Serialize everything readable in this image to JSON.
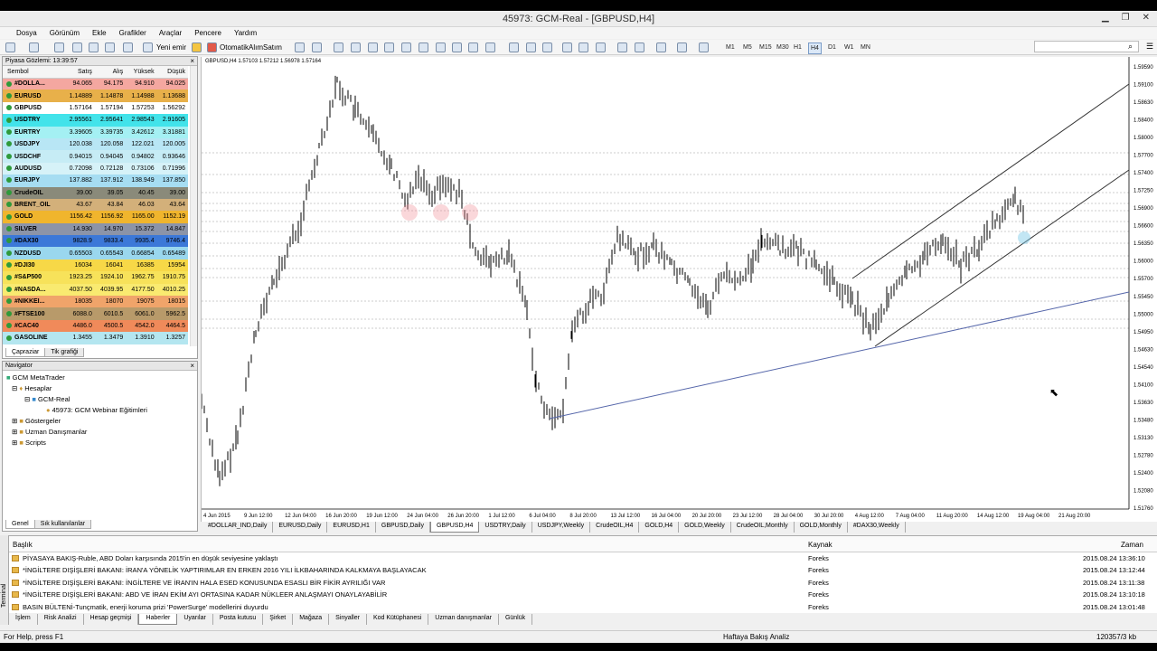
{
  "window": {
    "title": "45973: GCM-Real - [GBPUSD,H4]"
  },
  "menu": [
    "Dosya",
    "Görünüm",
    "Ekle",
    "Grafikler",
    "Araçlar",
    "Pencere",
    "Yardım"
  ],
  "toolbar": {
    "new_order": "Yeni emir",
    "auto_trading": "OtomatikAlımSatım",
    "timeframes": [
      "M1",
      "M5",
      "M15",
      "M30",
      "H1",
      "H4",
      "D1",
      "W1",
      "MN"
    ]
  },
  "market_watch": {
    "title": "Piyasa Gözlemi: 13:39:57",
    "columns": [
      "Sembol",
      "Satış",
      "Alış",
      "Yüksek",
      "Düşük"
    ],
    "rows": [
      {
        "sym": "#DOLLA...",
        "bid": "94.065",
        "ask": "94.175",
        "high": "94.910",
        "low": "94.025",
        "bg": "#f4a7a0"
      },
      {
        "sym": "EURUSD",
        "bid": "1.14889",
        "ask": "1.14878",
        "high": "1.14988",
        "low": "1.13688",
        "bg": "#e8b04a"
      },
      {
        "sym": "GBPUSD",
        "bid": "1.57164",
        "ask": "1.57194",
        "high": "1.57253",
        "low": "1.56292",
        "bg": "#ffffff"
      },
      {
        "sym": "USDTRY",
        "bid": "2.95561",
        "ask": "2.95641",
        "high": "2.98543",
        "low": "2.91605",
        "bg": "#42e3ea"
      },
      {
        "sym": "EURTRY",
        "bid": "3.39605",
        "ask": "3.39735",
        "high": "3.42612",
        "low": "3.31881",
        "bg": "#a4f0f3"
      },
      {
        "sym": "USDJPY",
        "bid": "120.038",
        "ask": "120.058",
        "high": "122.021",
        "low": "120.005",
        "bg": "#b8e6f5"
      },
      {
        "sym": "USDCHF",
        "bid": "0.94015",
        "ask": "0.94045",
        "high": "0.94802",
        "low": "0.93646",
        "bg": "#c6ecf5"
      },
      {
        "sym": "AUDUSD",
        "bid": "0.72098",
        "ask": "0.72128",
        "high": "0.73106",
        "low": "0.71996",
        "bg": "#d6f2f8"
      },
      {
        "sym": "EURJPY",
        "bid": "137.882",
        "ask": "137.912",
        "high": "138.949",
        "low": "137.850",
        "bg": "#a6ddf2"
      },
      {
        "sym": "CrudeOIL",
        "bid": "39.00",
        "ask": "39.05",
        "high": "40.45",
        "low": "39.00",
        "bg": "#8a8a7a"
      },
      {
        "sym": "BRENT_OIL",
        "bid": "43.67",
        "ask": "43.84",
        "high": "46.03",
        "low": "43.64",
        "bg": "#d3b07a"
      },
      {
        "sym": "GOLD",
        "bid": "1156.42",
        "ask": "1156.92",
        "high": "1165.00",
        "low": "1152.19",
        "bg": "#f0b52d"
      },
      {
        "sym": "SILVER",
        "bid": "14.930",
        "ask": "14.970",
        "high": "15.372",
        "low": "14.847",
        "bg": "#8c94a8"
      },
      {
        "sym": "#DAX30",
        "bid": "9828.9",
        "ask": "9833.4",
        "high": "9935.4",
        "low": "9746.4",
        "bg": "#3c78d8"
      },
      {
        "sym": "NZDUSD",
        "bid": "0.65503",
        "ask": "0.65543",
        "high": "0.66854",
        "low": "0.65489",
        "bg": "#9ad7ee"
      },
      {
        "sym": "#DJI30",
        "bid": "16034",
        "ask": "16041",
        "high": "16385",
        "low": "15954",
        "bg": "#f7d847"
      },
      {
        "sym": "#S&P500",
        "bid": "1923.25",
        "ask": "1924.10",
        "high": "1962.75",
        "low": "1910.75",
        "bg": "#f7e25a"
      },
      {
        "sym": "#NASDA...",
        "bid": "4037.50",
        "ask": "4039.95",
        "high": "4177.50",
        "low": "4010.25",
        "bg": "#f9ea70"
      },
      {
        "sym": "#NIKKEI...",
        "bid": "18035",
        "ask": "18070",
        "high": "19075",
        "low": "18015",
        "bg": "#f0a46a"
      },
      {
        "sym": "#FTSE100",
        "bid": "6088.0",
        "ask": "6010.5",
        "high": "6061.0",
        "low": "5962.5",
        "bg": "#b89a6a"
      },
      {
        "sym": "#CAC40",
        "bid": "4486.0",
        "ask": "4500.5",
        "high": "4542.0",
        "low": "4464.5",
        "bg": "#f08a5a"
      },
      {
        "sym": "GASOLINE",
        "bid": "1.3455",
        "ask": "1.3479",
        "high": "1.3910",
        "low": "1.3257",
        "bg": "#b4e6f0"
      }
    ],
    "tabs": [
      "Çapraziar",
      "Tik grafiği"
    ]
  },
  "navigator": {
    "title": "Navigator",
    "root": "GCM MetaTrader",
    "accounts": "Hesaplar",
    "server": "GCM-Real",
    "account": "45973: GCM Webinar Eğitimleri",
    "indicators": "Göstergeler",
    "experts": "Uzman Danışmanlar",
    "scripts": "Scripts",
    "tabs": [
      "Genel",
      "Sık kullanılanlar"
    ]
  },
  "chart": {
    "header": "GBPUSD,H4  1.57103 1.57212 1.56978 1.57164",
    "price_labels": [
      "1.59590",
      "1.59100",
      "1.58630",
      "1.58400",
      "1.58000",
      "1.57700",
      "1.57400",
      "1.57250",
      "1.56900",
      "1.56600",
      "1.56350",
      "1.56000",
      "1.55700",
      "1.55450",
      "1.55000",
      "1.54950",
      "1.54630",
      "1.54540",
      "1.54100",
      "1.53630",
      "1.53480",
      "1.53130",
      "1.52780",
      "1.52400",
      "1.52080",
      "1.51760"
    ],
    "date_labels": [
      "4 Jun 2015",
      "9 Jun 12:00",
      "12 Jun 04:00",
      "16 Jun 20:00",
      "19 Jun 12:00",
      "24 Jun 04:00",
      "26 Jun 20:00",
      "1 Jul 12:00",
      "6 Jul 04:00",
      "8 Jul 20:00",
      "13 Jul 12:00",
      "16 Jul 04:00",
      "20 Jul 20:00",
      "23 Jul 12:00",
      "28 Jul 04:00",
      "30 Jul 20:00",
      "4 Aug 12:00",
      "7 Aug 04:00",
      "11 Aug 20:00",
      "14 Aug 12:00",
      "19 Aug 04:00",
      "21 Aug 20:00"
    ]
  },
  "chart_tabs": [
    "#DOLLAR_IND,Daily",
    "EURUSD,Daily",
    "EURUSD,H1",
    "GBPUSD,Daily",
    "GBPUSD,H4",
    "USDTRY,Daily",
    "USDJPY,Weekly",
    "CrudeOIL,H4",
    "GOLD,H4",
    "GOLD,Weekly",
    "CrudeOIL,Monthly",
    "GOLD,Monthly",
    "#DAX30,Weekly"
  ],
  "news": {
    "columns": [
      "Başlık",
      "Kaynak",
      "Zaman"
    ],
    "rows": [
      {
        "title": "PİYASAYA BAKIŞ-Ruble, ABD Doları karşısında 2015'in en düşük seviyesine yaklaştı",
        "source": "Foreks",
        "time": "2015.08.24 13:36:10"
      },
      {
        "title": "*İNGİLTERE DIŞİŞLERİ BAKANI: İRAN'A YÖNELİK YAPTIRIMLAR EN ERKEN 2016 YILI İLKBAHARINDA KALKMAYA BAŞLAYACAK",
        "source": "Foreks",
        "time": "2015.08.24 13:12:44"
      },
      {
        "title": "*İNGİLTERE DIŞİŞLERİ BAKANI: İNGİLTERE VE İRAN'IN HALA ESED KONUSUNDA ESASLI BİR FİKİR AYRILIĞI VAR",
        "source": "Foreks",
        "time": "2015.08.24 13:11:38"
      },
      {
        "title": "*İNGİLTERE DIŞİŞLERİ BAKANI: ABD VE İRAN EKİM AYI ORTASINA KADAR NÜKLEER ANLAŞMAYI ONAYLAYABİLİR",
        "source": "Foreks",
        "time": "2015.08.24 13:10:18"
      },
      {
        "title": "BASIN BÜLTENİ-Tunçmatik, enerji koruma prizi 'PowerSurge' modellerini duyurdu",
        "source": "Foreks",
        "time": "2015.08.24 13:01:48"
      }
    ]
  },
  "bottom_tabs": [
    "İşlem",
    "Risk Analizi",
    "Hesap geçmişi",
    "Haberler",
    "Uyarılar",
    "Posta kutusu",
    "Şirket",
    "Mağaza",
    "Sinyaller",
    "Kod Kütüphanesi",
    "Uzman danışmanlar",
    "Günlük"
  ],
  "terminal_label": "Terminal",
  "status": {
    "help": "For Help, press F1",
    "profile": "Haftaya Bakış Analiz",
    "traffic": "120357/3 kb"
  }
}
